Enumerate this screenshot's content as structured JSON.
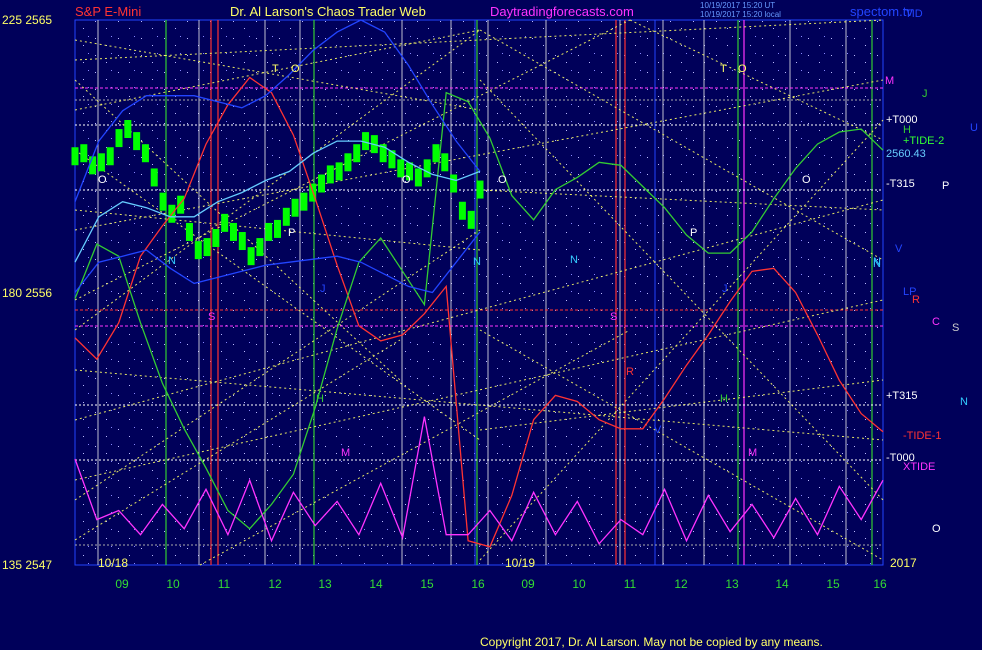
{
  "header": {
    "left_label": "S&P E-Mini",
    "title": "Dr. Al Larson's Chaos Trader Web",
    "site": "Daytradingforecasts.com",
    "update_line1": "10/19/2017 15:20 UT",
    "update_line2": "10/19/2017 15:20 local",
    "brand": "spectom.tv"
  },
  "colors": {
    "background": "#00005a",
    "price_bars": "#00ff00",
    "xtide": "#ff33ff",
    "tide1": "#ff3333",
    "tide2": "#33cc33",
    "band": "#2244ff",
    "grid": "#e8e8e8",
    "flux": "#ffff66"
  },
  "copyright": "Copyright 2017, Dr. Al Larson. May not be copied by any means.",
  "chart_data": {
    "type": "line",
    "title": "S&P E-Mini",
    "y_axis_left": [
      {
        "label_a": "225",
        "label_b": "2565",
        "value": 2565
      },
      {
        "label_a": "180",
        "label_b": "2556",
        "value": 2556
      },
      {
        "label_a": "135",
        "label_b": "2547",
        "value": 2547
      }
    ],
    "ylim": [
      2547,
      2565
    ],
    "x_ticks": [
      "09",
      "10",
      "11",
      "12",
      "13",
      "14",
      "15",
      "16",
      "09",
      "10",
      "11",
      "12",
      "13",
      "14",
      "15",
      "16"
    ],
    "date_labels": [
      "10/18",
      "10/19",
      "2017"
    ],
    "last_price_label": "2560.43",
    "right_labels": [
      {
        "text": "M",
        "color": "#ff33ff"
      },
      {
        "text": "J",
        "color": "#33cc33"
      },
      {
        "text": "+T000",
        "color": "#ffffff"
      },
      {
        "text": "H",
        "color": "#33cc33"
      },
      {
        "text": "U",
        "color": "#2244ff"
      },
      {
        "text": "+TIDE-2",
        "color": "#33ff33"
      },
      {
        "text": "2560.43",
        "color": "#66ccff"
      },
      {
        "text": "-T315",
        "color": "#ffffff"
      },
      {
        "text": "P",
        "color": "#ffffff"
      },
      {
        "text": "V",
        "color": "#2244ff"
      },
      {
        "text": "N",
        "color": "#33ccff"
      },
      {
        "text": "LP",
        "color": "#2244ff"
      },
      {
        "text": "R",
        "color": "#ff3333"
      },
      {
        "text": "C",
        "color": "#ff33ff"
      },
      {
        "text": "S",
        "color": "#cccccc"
      },
      {
        "text": "+T315",
        "color": "#ffffff"
      },
      {
        "text": "N",
        "color": "#33ccff"
      },
      {
        "text": "-TIDE-1",
        "color": "#ff3333"
      },
      {
        "text": "-T000",
        "color": "#ffffff"
      },
      {
        "text": "XTIDE",
        "color": "#ff33ff"
      },
      {
        "text": "O",
        "color": "#ffffff"
      },
      {
        "text": "TID",
        "color": "#2244ff"
      }
    ],
    "planet_markers": [
      {
        "text": "O",
        "color": "#ffffff"
      },
      {
        "text": "N",
        "color": "#33ccff"
      },
      {
        "text": "S",
        "color": "#ff33ff"
      },
      {
        "text": "T",
        "color": "#ffff66"
      },
      {
        "text": "O",
        "color": "#ffff66"
      },
      {
        "text": "P",
        "color": "#ffffff"
      },
      {
        "text": "J",
        "color": "#2244ff"
      },
      {
        "text": "H",
        "color": "#33cc33"
      },
      {
        "text": "M",
        "color": "#ff33ff"
      },
      {
        "text": "O",
        "color": "#ffffff"
      },
      {
        "text": "N",
        "color": "#33ccff"
      },
      {
        "text": "O",
        "color": "#ffffff"
      },
      {
        "text": "N",
        "color": "#33ccff"
      },
      {
        "text": "S",
        "color": "#ff33ff"
      },
      {
        "text": "R",
        "color": "#ff3333"
      },
      {
        "text": "P",
        "color": "#ffffff"
      },
      {
        "text": "T",
        "color": "#ffff66"
      },
      {
        "text": "O",
        "color": "#ffff66"
      },
      {
        "text": "J",
        "color": "#2244ff"
      },
      {
        "text": "H",
        "color": "#33cc33"
      },
      {
        "text": "M",
        "color": "#ff33ff"
      },
      {
        "text": "O",
        "color": "#ffffff"
      },
      {
        "text": "N",
        "color": "#33ccff"
      },
      {
        "text": "V",
        "color": "#2244ff"
      }
    ],
    "series": [
      {
        "color": "#00ff00",
        "style": "bars",
        "values": [
          2560.5,
          2560.6,
          2560.2,
          2560.3,
          2560.5,
          2561.1,
          2561.4,
          2561.0,
          2560.6,
          2559.8,
          2559.0,
          2558.6,
          2558.9,
          2558.0,
          2557.4,
          2557.5,
          2557.8,
          2558.3,
          2558.0,
          2557.7,
          2557.2,
          2557.5,
          2558.0,
          2558.1,
          2558.5,
          2558.8,
          2559.0,
          2559.3,
          2559.6,
          2559.9,
          2560.0,
          2560.3,
          2560.6,
          2561.0,
          2560.9,
          2560.6,
          2560.4,
          2560.1,
          2560.0,
          2559.8,
          2560.1,
          2560.6,
          2560.3,
          2559.6,
          2558.7,
          2558.4,
          2559.4
        ]
      },
      {
        "color": "#ff3333",
        "values": [
          2554.5,
          2553.8,
          2555.0,
          2557.2,
          2558.2,
          2559.1,
          2560.9,
          2562.2,
          2563.1,
          2562.6,
          2561.2,
          2559.1,
          2556.9,
          2554.9,
          2554.4,
          2554.6,
          2555.3,
          2556.2,
          2547.8,
          2547.6,
          2549.3,
          2551.8,
          2552.6,
          2552.4,
          2551.8,
          2551.5,
          2551.5,
          2552.5,
          2553.6,
          2554.6,
          2555.7,
          2556.7,
          2556.8,
          2556.0,
          2554.6,
          2553.1,
          2552.0,
          2551.4
        ]
      },
      {
        "color": "#33cc33",
        "values": [
          2555.8,
          2557.6,
          2557.2,
          2555.0,
          2553.0,
          2551.5,
          2550.2,
          2548.8,
          2548.2,
          2549.0,
          2550.0,
          2552.2,
          2554.8,
          2557.0,
          2557.8,
          2556.7,
          2555.6,
          2562.6,
          2562.3,
          2561.1,
          2559.2,
          2558.4,
          2559.4,
          2559.8,
          2560.3,
          2560.2,
          2559.5,
          2558.8,
          2557.9,
          2557.3,
          2557.3,
          2558.0,
          2559.1,
          2560.1,
          2560.9,
          2561.3,
          2561.4,
          2560.7
        ]
      },
      {
        "color": "#2244ff",
        "values": [
          2559.0,
          2561.0,
          2562.0,
          2562.5,
          2562.5,
          2562.5,
          2562.3,
          2562.1,
          2562.5,
          2563.2,
          2564.0,
          2564.6,
          2565.0,
          2564.6,
          2563.5,
          2562.2,
          2561.0,
          2560.0
        ]
      },
      {
        "color": "#2244ff",
        "values": [
          2556.0,
          2557.0,
          2557.2,
          2557.4,
          2556.8,
          2556.3,
          2556.5,
          2556.7,
          2556.9,
          2557.0,
          2557.1,
          2557.2,
          2557.0,
          2556.6,
          2556.2,
          2556.0,
          2557.0,
          2558.0
        ]
      },
      {
        "color": "#66ccff",
        "values": [
          2557.0,
          2558.5,
          2559.0,
          2558.8,
          2558.5,
          2558.5,
          2559.0,
          2559.3,
          2559.7,
          2560.0,
          2560.6,
          2561.0,
          2561.0,
          2560.8,
          2560.3,
          2559.9,
          2559.7,
          2560.0
        ]
      },
      {
        "color": "#ff33ff",
        "values": [
          2550.5,
          2548.5,
          2548.8,
          2548.0,
          2549.0,
          2548.2,
          2549.5,
          2548.0,
          2549.8,
          2547.8,
          2549.4,
          2548.3,
          2549.1,
          2548.0,
          2549.7,
          2547.9,
          2551.9,
          2548.0,
          2548.0,
          2548.8,
          2547.8,
          2549.4,
          2548.0,
          2549.1,
          2547.7,
          2548.5,
          2548.0,
          2549.5,
          2547.8,
          2549.3,
          2548.1,
          2549.0,
          2547.9,
          2549.2,
          2548.0,
          2549.6,
          2548.5,
          2549.8
        ]
      }
    ]
  }
}
